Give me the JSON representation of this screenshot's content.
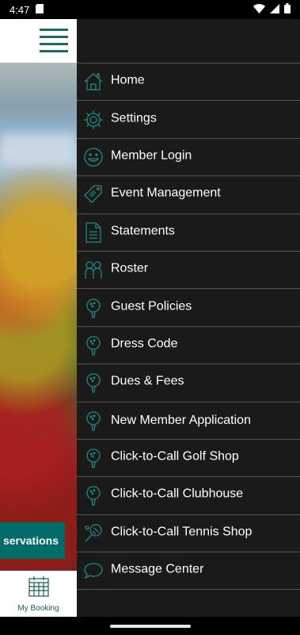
{
  "status_bar": {
    "time": "4:47",
    "icons": [
      "sd-card-icon",
      "wifi-icon",
      "signal-icon",
      "battery-icon"
    ]
  },
  "header": {
    "menu_icon": "hamburger-icon",
    "accent_color": "#1f6b67"
  },
  "hero": {
    "reservation_label": "servations"
  },
  "bottom_nav": {
    "icon": "calendar-icon",
    "label": "My Booking"
  },
  "drawer": {
    "background": "#1a1a1a",
    "items": [
      {
        "label": "Home",
        "icon": "home-icon"
      },
      {
        "label": "Settings",
        "icon": "gear-icon"
      },
      {
        "label": "Member Login",
        "icon": "smiley-icon"
      },
      {
        "label": "Event Management",
        "icon": "tag-icon"
      },
      {
        "label": "Statements",
        "icon": "document-icon"
      },
      {
        "label": "Roster",
        "icon": "people-icon"
      },
      {
        "label": "Guest Policies",
        "icon": "golf-ball-icon"
      },
      {
        "label": "Dress Code",
        "icon": "golf-ball-icon"
      },
      {
        "label": "Dues & Fees",
        "icon": "golf-ball-icon"
      },
      {
        "label": "New Member Application",
        "icon": "golf-ball-icon"
      },
      {
        "label": "Click-to-Call Golf Shop",
        "icon": "golf-ball-icon"
      },
      {
        "label": "Click-to-Call Clubhouse",
        "icon": "golf-ball-icon"
      },
      {
        "label": "Click-to-Call Tennis Shop",
        "icon": "tennis-racket-icon"
      },
      {
        "label": "Message Center",
        "icon": "chat-bubble-icon"
      }
    ]
  }
}
